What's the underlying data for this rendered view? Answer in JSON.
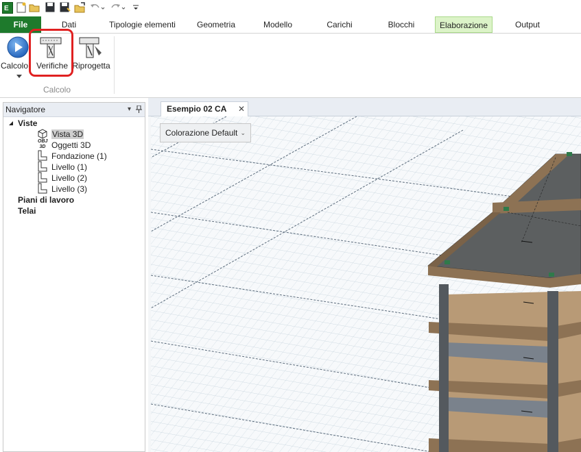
{
  "quick_access": {
    "icons": [
      "app-logo-icon",
      "new-file-icon",
      "open-folder-icon",
      "save-icon",
      "save-as-icon",
      "open-icon",
      "undo-icon",
      "redo-icon",
      "customize-icon"
    ]
  },
  "menu": {
    "file": "File",
    "tabs": [
      "Dati",
      "Tipologie elementi",
      "Geometria",
      "Modello",
      "Carichi",
      "Blocchi",
      "Elaborazione",
      "Output"
    ],
    "active_tab": "Elaborazione"
  },
  "ribbon": {
    "buttons": [
      {
        "label": "Calcolo"
      },
      {
        "label": "Verifiche"
      },
      {
        "label": "Riprogetta"
      }
    ],
    "group_label": "Calcolo"
  },
  "navigator": {
    "title": "Navigatore",
    "pin": "📌",
    "dropdown": "▾",
    "tree": {
      "views_label": "Viste",
      "expand": "◢",
      "items": [
        "Vista 3D",
        "Oggetti 3D",
        "Fondazione (1)",
        "Livello (1)",
        "Livello (2)",
        "Livello (3)"
      ],
      "obj_tag": "OBJ 3D",
      "selected": "Vista 3D",
      "workplanes_label": "Piani di lavoro",
      "frames_label": "Telai"
    }
  },
  "document": {
    "tab_label": "Esempio 02 CA",
    "close": "✕"
  },
  "viewport": {
    "coloring_label": "Colorazione Default",
    "chevron": "⌄"
  },
  "colors": {
    "file_tab": "#1e7a2c",
    "active_tab": "#dcf3c8",
    "highlight": "#e02020",
    "slab": "#5c5f60",
    "beam": "#8d7254",
    "grid": "#c9d6df"
  }
}
